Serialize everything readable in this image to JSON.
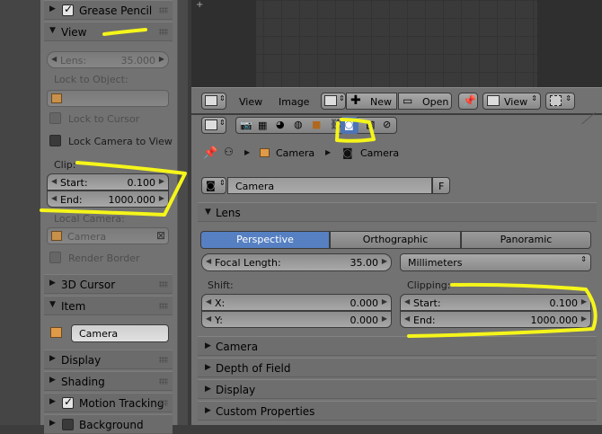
{
  "left_panel": {
    "grease_pencil": {
      "label": "Grease Pencil",
      "checked": true
    },
    "view": {
      "label": "View",
      "lens_label": "Lens:",
      "lens_value": "35.000",
      "lock_to_object_label": "Lock to Object:",
      "lock_to_cursor_label": "Lock to Cursor",
      "lock_camera_to_view_label": "Lock Camera to View",
      "clip_label": "Clip:",
      "clip_start_label": "Start:",
      "clip_start_value": "0.100",
      "clip_end_label": "End:",
      "clip_end_value": "1000.000",
      "local_camera_label": "Local Camera:",
      "local_camera_value": "Camera",
      "render_border_label": "Render Border"
    },
    "cursor_3d": {
      "label": "3D Cursor"
    },
    "item": {
      "label": "Item",
      "name_value": "Camera"
    },
    "display": {
      "label": "Display"
    },
    "shading": {
      "label": "Shading"
    },
    "motion_tracking": {
      "label": "Motion Tracking",
      "checked": true
    },
    "background_images": {
      "label": "Background Images"
    }
  },
  "image_editor_header": {
    "menus": [
      "View",
      "Image"
    ],
    "new_label": "New",
    "open_label": "Open",
    "view_select": "View"
  },
  "properties": {
    "breadcrumb": [
      "Camera",
      "Camera"
    ],
    "datablock_name": "Camera",
    "fake_user": "F",
    "lens_panel": {
      "label": "Lens",
      "tabs": [
        "Perspective",
        "Orthographic",
        "Panoramic"
      ],
      "active_tab": "Perspective",
      "focal_length_label": "Focal Length:",
      "focal_length_value": "35.00",
      "lens_unit": "Millimeters",
      "shift_label": "Shift:",
      "shift_x_label": "X:",
      "shift_x_value": "0.000",
      "shift_y_label": "Y:",
      "shift_y_value": "0.000",
      "clipping_label": "Clipping:",
      "clip_start_label": "Start:",
      "clip_start_value": "0.100",
      "clip_end_label": "End:",
      "clip_end_value": "1000.000"
    },
    "collapsed_panels": [
      "Camera",
      "Depth of Field",
      "Display",
      "Custom Properties"
    ]
  },
  "colors": {
    "annotation": "#f5f51a",
    "active_tab": "#5680c2",
    "panel_bg": "#727272"
  }
}
